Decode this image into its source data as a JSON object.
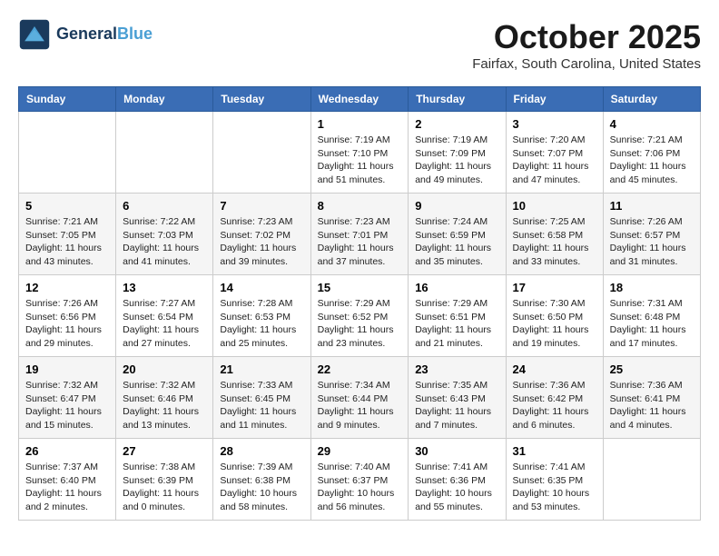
{
  "header": {
    "logo_line1": "General",
    "logo_line2": "Blue",
    "month_title": "October 2025",
    "location": "Fairfax, South Carolina, United States"
  },
  "days_of_week": [
    "Sunday",
    "Monday",
    "Tuesday",
    "Wednesday",
    "Thursday",
    "Friday",
    "Saturday"
  ],
  "weeks": [
    [
      {
        "day": "",
        "info": ""
      },
      {
        "day": "",
        "info": ""
      },
      {
        "day": "",
        "info": ""
      },
      {
        "day": "1",
        "info": "Sunrise: 7:19 AM\nSunset: 7:10 PM\nDaylight: 11 hours\nand 51 minutes."
      },
      {
        "day": "2",
        "info": "Sunrise: 7:19 AM\nSunset: 7:09 PM\nDaylight: 11 hours\nand 49 minutes."
      },
      {
        "day": "3",
        "info": "Sunrise: 7:20 AM\nSunset: 7:07 PM\nDaylight: 11 hours\nand 47 minutes."
      },
      {
        "day": "4",
        "info": "Sunrise: 7:21 AM\nSunset: 7:06 PM\nDaylight: 11 hours\nand 45 minutes."
      }
    ],
    [
      {
        "day": "5",
        "info": "Sunrise: 7:21 AM\nSunset: 7:05 PM\nDaylight: 11 hours\nand 43 minutes."
      },
      {
        "day": "6",
        "info": "Sunrise: 7:22 AM\nSunset: 7:03 PM\nDaylight: 11 hours\nand 41 minutes."
      },
      {
        "day": "7",
        "info": "Sunrise: 7:23 AM\nSunset: 7:02 PM\nDaylight: 11 hours\nand 39 minutes."
      },
      {
        "day": "8",
        "info": "Sunrise: 7:23 AM\nSunset: 7:01 PM\nDaylight: 11 hours\nand 37 minutes."
      },
      {
        "day": "9",
        "info": "Sunrise: 7:24 AM\nSunset: 6:59 PM\nDaylight: 11 hours\nand 35 minutes."
      },
      {
        "day": "10",
        "info": "Sunrise: 7:25 AM\nSunset: 6:58 PM\nDaylight: 11 hours\nand 33 minutes."
      },
      {
        "day": "11",
        "info": "Sunrise: 7:26 AM\nSunset: 6:57 PM\nDaylight: 11 hours\nand 31 minutes."
      }
    ],
    [
      {
        "day": "12",
        "info": "Sunrise: 7:26 AM\nSunset: 6:56 PM\nDaylight: 11 hours\nand 29 minutes."
      },
      {
        "day": "13",
        "info": "Sunrise: 7:27 AM\nSunset: 6:54 PM\nDaylight: 11 hours\nand 27 minutes."
      },
      {
        "day": "14",
        "info": "Sunrise: 7:28 AM\nSunset: 6:53 PM\nDaylight: 11 hours\nand 25 minutes."
      },
      {
        "day": "15",
        "info": "Sunrise: 7:29 AM\nSunset: 6:52 PM\nDaylight: 11 hours\nand 23 minutes."
      },
      {
        "day": "16",
        "info": "Sunrise: 7:29 AM\nSunset: 6:51 PM\nDaylight: 11 hours\nand 21 minutes."
      },
      {
        "day": "17",
        "info": "Sunrise: 7:30 AM\nSunset: 6:50 PM\nDaylight: 11 hours\nand 19 minutes."
      },
      {
        "day": "18",
        "info": "Sunrise: 7:31 AM\nSunset: 6:48 PM\nDaylight: 11 hours\nand 17 minutes."
      }
    ],
    [
      {
        "day": "19",
        "info": "Sunrise: 7:32 AM\nSunset: 6:47 PM\nDaylight: 11 hours\nand 15 minutes."
      },
      {
        "day": "20",
        "info": "Sunrise: 7:32 AM\nSunset: 6:46 PM\nDaylight: 11 hours\nand 13 minutes."
      },
      {
        "day": "21",
        "info": "Sunrise: 7:33 AM\nSunset: 6:45 PM\nDaylight: 11 hours\nand 11 minutes."
      },
      {
        "day": "22",
        "info": "Sunrise: 7:34 AM\nSunset: 6:44 PM\nDaylight: 11 hours\nand 9 minutes."
      },
      {
        "day": "23",
        "info": "Sunrise: 7:35 AM\nSunset: 6:43 PM\nDaylight: 11 hours\nand 7 minutes."
      },
      {
        "day": "24",
        "info": "Sunrise: 7:36 AM\nSunset: 6:42 PM\nDaylight: 11 hours\nand 6 minutes."
      },
      {
        "day": "25",
        "info": "Sunrise: 7:36 AM\nSunset: 6:41 PM\nDaylight: 11 hours\nand 4 minutes."
      }
    ],
    [
      {
        "day": "26",
        "info": "Sunrise: 7:37 AM\nSunset: 6:40 PM\nDaylight: 11 hours\nand 2 minutes."
      },
      {
        "day": "27",
        "info": "Sunrise: 7:38 AM\nSunset: 6:39 PM\nDaylight: 11 hours\nand 0 minutes."
      },
      {
        "day": "28",
        "info": "Sunrise: 7:39 AM\nSunset: 6:38 PM\nDaylight: 10 hours\nand 58 minutes."
      },
      {
        "day": "29",
        "info": "Sunrise: 7:40 AM\nSunset: 6:37 PM\nDaylight: 10 hours\nand 56 minutes."
      },
      {
        "day": "30",
        "info": "Sunrise: 7:41 AM\nSunset: 6:36 PM\nDaylight: 10 hours\nand 55 minutes."
      },
      {
        "day": "31",
        "info": "Sunrise: 7:41 AM\nSunset: 6:35 PM\nDaylight: 10 hours\nand 53 minutes."
      },
      {
        "day": "",
        "info": ""
      }
    ]
  ]
}
